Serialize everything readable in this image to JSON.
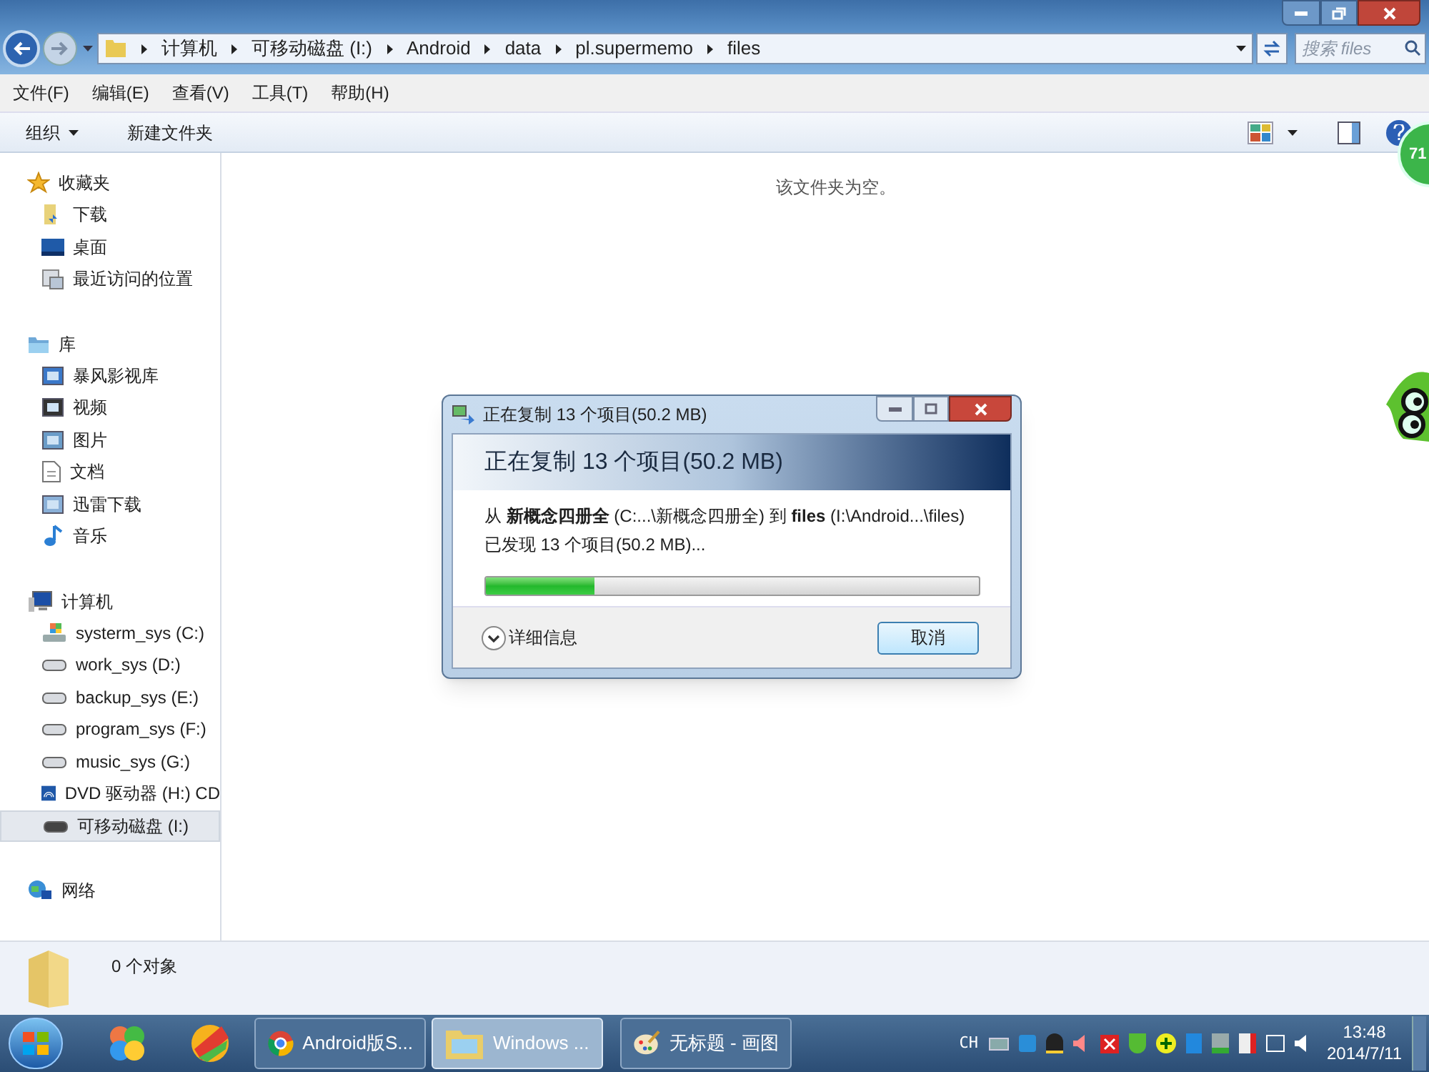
{
  "address_bar": {
    "crumbs": [
      "计算机",
      "可移动磁盘 (I:)",
      "Android",
      "data",
      "pl.supermemo",
      "files"
    ],
    "search": {
      "placeholder": "搜索 files"
    }
  },
  "menu_bar": [
    "文件(F)",
    "编辑(E)",
    "查看(V)",
    "工具(T)",
    "帮助(H)"
  ],
  "toolbar": {
    "buttons": [
      "组织",
      "新建文件夹"
    ]
  },
  "sidebar": {
    "groups": [
      {
        "label": "收藏夹",
        "items": [
          {
            "label": "下载",
            "selected": false
          },
          {
            "label": "桌面",
            "selected": false
          },
          {
            "label": "最近访问的位置",
            "selected": false
          }
        ]
      },
      {
        "label": "库",
        "items": [
          {
            "label": "暴风影视库",
            "selected": false
          },
          {
            "label": "视频",
            "selected": false
          },
          {
            "label": "图片",
            "selected": false
          },
          {
            "label": "文档",
            "selected": false
          },
          {
            "label": "迅雷下载",
            "selected": false
          },
          {
            "label": "音乐",
            "selected": false
          }
        ]
      },
      {
        "label": "计算机",
        "items": [
          {
            "label": "systerm_sys (C:)",
            "selected": false
          },
          {
            "label": "work_sys (D:)",
            "selected": false
          },
          {
            "label": "backup_sys (E:)",
            "selected": false
          },
          {
            "label": "program_sys (F:)",
            "selected": false
          },
          {
            "label": "music_sys (G:)",
            "selected": false
          },
          {
            "label": "DVD 驱动器 (H:) CD",
            "selected": false
          },
          {
            "label": "可移动磁盘 (I:)",
            "selected": true
          }
        ]
      },
      {
        "label": "网络"
      }
    ]
  },
  "content": {
    "empty_message": "该文件夹为空。"
  },
  "floating_badge": "71",
  "status_bar": {
    "count": "0 个对象"
  },
  "copy_dialog": {
    "title": "正在复制 13 个项目(50.2 MB)",
    "heading": "正在复制 13 个项目(50.2 MB)",
    "from_to": "从 **新概念四册全** (C:...\\新概念四册全) 到 **files** (I:\\Android...\\files)",
    "found": "已发现 13 个项目(50.2 MB)...",
    "progress": {
      "level": 0.22
    },
    "details": "详细信息",
    "cancel": "取消"
  },
  "taskbar": {
    "tasks": [
      {
        "label": "Android版S...",
        "selected": false
      },
      {
        "label": "Windows ...",
        "selected": true
      },
      {
        "label": "无标题 - 画图",
        "selected": false
      }
    ],
    "lang": "CH",
    "time": "13:48",
    "date": "2014/7/11"
  }
}
